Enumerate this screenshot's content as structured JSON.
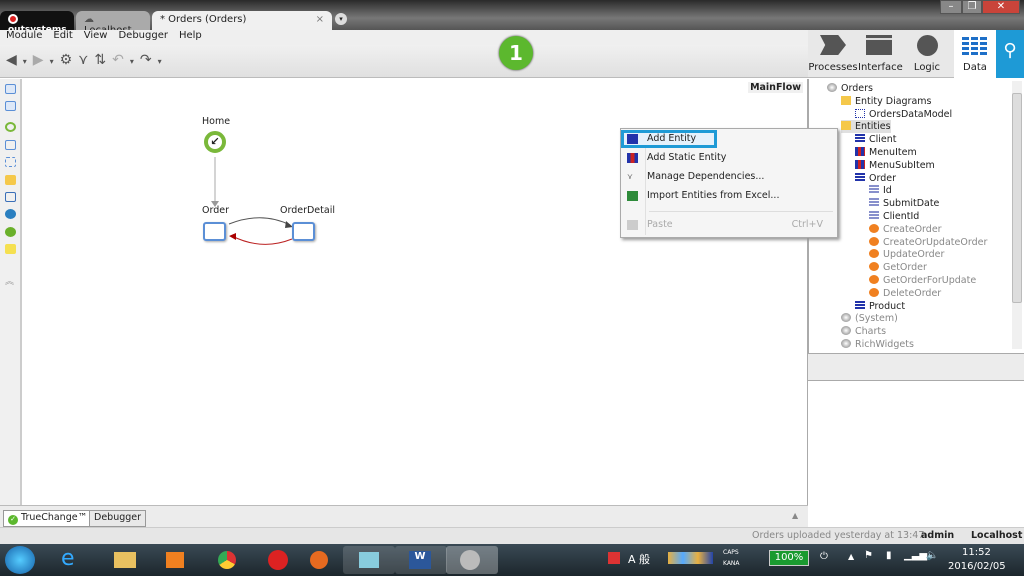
{
  "tabs": [
    {
      "label": "outsystems"
    },
    {
      "label": "Localhost"
    },
    {
      "label": "* Orders (Orders)",
      "close": "×"
    }
  ],
  "menu": [
    "Module",
    "Edit",
    "View",
    "Debugger",
    "Help"
  ],
  "step_badge": "1",
  "views": [
    {
      "label": "Processes",
      "icon": "processes-icon"
    },
    {
      "label": "Interface",
      "icon": "interface-icon"
    },
    {
      "label": "Logic",
      "icon": "logic-icon"
    },
    {
      "label": "Data",
      "icon": "data-icon",
      "active": true
    }
  ],
  "canvas": {
    "flow_tab": "MainFlow",
    "nodes": {
      "home": "Home",
      "order": "Order",
      "detail": "OrderDetail"
    }
  },
  "tree": [
    {
      "label": "Orders",
      "icon": "module-icon"
    },
    {
      "label": "Entity Diagrams",
      "icon": "folder-icon"
    },
    {
      "label": "OrdersDataModel",
      "icon": "diagram-icon"
    },
    {
      "label": "Entities",
      "icon": "folder-icon",
      "selected": true
    },
    {
      "label": "Client",
      "icon": "entity-icon"
    },
    {
      "label": "MenuItem",
      "icon": "static-entity-icon"
    },
    {
      "label": "MenuSubItem",
      "icon": "static-entity-icon"
    },
    {
      "label": "Order",
      "icon": "entity-icon"
    },
    {
      "label": "Id",
      "icon": "attribute-icon"
    },
    {
      "label": "SubmitDate",
      "icon": "attribute-icon"
    },
    {
      "label": "ClientId",
      "icon": "attribute-icon"
    },
    {
      "label": "CreateOrder",
      "icon": "action-icon"
    },
    {
      "label": "CreateOrUpdateOrder",
      "icon": "action-icon"
    },
    {
      "label": "UpdateOrder",
      "icon": "action-icon"
    },
    {
      "label": "GetOrder",
      "icon": "action-icon"
    },
    {
      "label": "GetOrderForUpdate",
      "icon": "action-icon"
    },
    {
      "label": "DeleteOrder",
      "icon": "action-icon"
    },
    {
      "label": "Product",
      "icon": "entity-icon"
    },
    {
      "label": "(System)",
      "icon": "module-icon"
    },
    {
      "label": "Charts",
      "icon": "module-icon"
    },
    {
      "label": "RichWidgets",
      "icon": "module-icon"
    }
  ],
  "context_menu": [
    {
      "label": "Add Entity",
      "highlighted": true
    },
    {
      "label": "Add Static Entity"
    },
    {
      "label": "Manage Dependencies..."
    },
    {
      "label": "Import Entities from Excel..."
    },
    {
      "label": "Paste",
      "shortcut": "Ctrl+V",
      "disabled": true
    }
  ],
  "bottom_tabs": [
    "TrueChange™",
    "Debugger"
  ],
  "status": {
    "message": "Orders uploaded yesterday at 13:47",
    "user": "admin",
    "server": "Localhost"
  },
  "taskbar": {
    "battery": "100%",
    "time": "11:52",
    "date": "2016/02/05",
    "caps": "CAPS",
    "kana": "KANA",
    "ime": "A 般"
  },
  "colors": {
    "accent": "#1e9ad6",
    "badge": "#5cb82e",
    "entity": "#2233aa",
    "action": "#f08020"
  }
}
